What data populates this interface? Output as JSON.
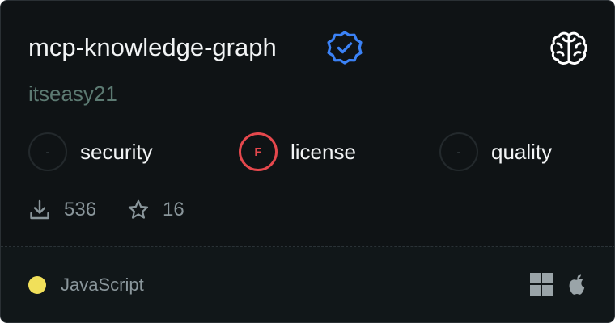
{
  "package": {
    "name": "mcp-knowledge-graph",
    "author": "itseasy21"
  },
  "metrics": [
    {
      "grade": "-",
      "label": "security",
      "status": "none"
    },
    {
      "grade": "F",
      "label": "license",
      "status": "fail"
    },
    {
      "grade": "-",
      "label": "quality",
      "status": "none"
    }
  ],
  "stats": {
    "downloads": "536",
    "stars": "16"
  },
  "footer": {
    "language": "JavaScript",
    "language_color": "#f1e05a",
    "platforms": [
      "windows-icon",
      "apple-icon"
    ]
  },
  "icons": {
    "verified": "verified-badge-icon",
    "category": "brain-icon",
    "downloads": "download-icon",
    "stars": "star-icon"
  },
  "colors": {
    "verified": "#3b82f6",
    "fail": "#e5484d",
    "author": "#5c7a72"
  }
}
